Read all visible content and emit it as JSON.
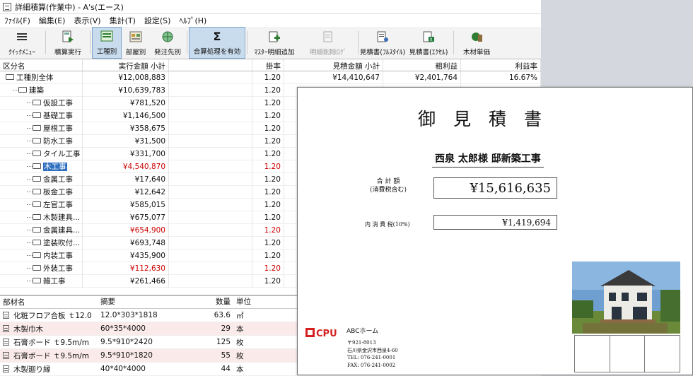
{
  "window": {
    "title": "詳細積算(作業中) - A's(エース)"
  },
  "menu": [
    "ﾌｧｲﾙ(F)",
    "編集(E)",
    "表示(V)",
    "集計(T)",
    "設定(S)",
    "ﾍﾙﾌﾟ(H)"
  ],
  "toolbar": {
    "quickmenu": "ｸｲｯｸﾒﾆｭｰ",
    "estimate_run": "積算実行",
    "by_trade": "工種別",
    "by_room": "部屋別",
    "by_order": "発注先別",
    "sum_enable": "合算処理を有効",
    "master_add": "ﾏｽﾀｰ明細追加",
    "detail_delete": "明細削除ﾛｸﾞ",
    "quote_fullstyle": "見積書(ﾌﾙｽﾀｲﾙ)",
    "quote_excel": "見積書(ｴｸｾﾙ)",
    "wood_price": "木材単価"
  },
  "grid": {
    "headers": {
      "name": "区分名",
      "amount": "実行金額 小計",
      "rate": "掛率",
      "est": "見積金額 小計",
      "profit": "粗利益",
      "pct": "利益率"
    },
    "rows": [
      {
        "name": "工種別全体",
        "amount": "¥12,008,883",
        "rate": "1.20",
        "est": "¥14,410,647",
        "profit": "¥2,401,764",
        "pct": "16.67%",
        "level": 0
      },
      {
        "name": "建築",
        "amount": "¥10,639,783",
        "rate": "1.20",
        "level": 1
      },
      {
        "name": "仮設工事",
        "amount": "¥781,520",
        "rate": "1.20",
        "level": 2
      },
      {
        "name": "基礎工事",
        "amount": "¥1,146,500",
        "rate": "1.20",
        "level": 2
      },
      {
        "name": "屋根工事",
        "amount": "¥358,675",
        "rate": "1.20",
        "level": 2
      },
      {
        "name": "防水工事",
        "amount": "¥31,500",
        "rate": "1.20",
        "level": 2
      },
      {
        "name": "タイル工事",
        "amount": "¥331,700",
        "rate": "1.20",
        "level": 2
      },
      {
        "name": "木工事",
        "amount": "¥4,540,870",
        "rate": "1.20",
        "level": 2,
        "red": true,
        "selected": true
      },
      {
        "name": "金属工事",
        "amount": "¥17,640",
        "rate": "1.20",
        "level": 2
      },
      {
        "name": "板金工事",
        "amount": "¥12,642",
        "rate": "1.20",
        "level": 2
      },
      {
        "name": "左官工事",
        "amount": "¥585,015",
        "rate": "1.20",
        "level": 2
      },
      {
        "name": "木製建具...",
        "amount": "¥675,077",
        "rate": "1.20",
        "level": 2
      },
      {
        "name": "金属建具...",
        "amount": "¥654,900",
        "rate": "1.20",
        "level": 2,
        "red": true
      },
      {
        "name": "塗装吹付...",
        "amount": "¥693,748",
        "rate": "1.20",
        "level": 2
      },
      {
        "name": "内装工事",
        "amount": "¥435,900",
        "rate": "1.20",
        "level": 2
      },
      {
        "name": "外装工事",
        "amount": "¥112,630",
        "rate": "1.20",
        "level": 2,
        "red": true
      },
      {
        "name": "雑工事",
        "amount": "¥261,466",
        "rate": "1.20",
        "level": 2
      }
    ]
  },
  "parts": {
    "headers": {
      "name": "部材名",
      "spec": "摘要",
      "qty": "数量",
      "unit": "単位"
    },
    "rows": [
      {
        "name": "化粧フロア合板 ｔ12.0",
        "spec": "12.0*303*1818",
        "qty": "63.6",
        "unit": "㎡",
        "pink": false
      },
      {
        "name": "木製巾木",
        "spec": "60*35*4000",
        "qty": "29",
        "unit": "本",
        "pink": true
      },
      {
        "name": "石膏ボード ｔ9.5m/m",
        "spec": "9.5*910*2420",
        "qty": "125",
        "unit": "枚",
        "pink": false
      },
      {
        "name": "石膏ボード ｔ9.5m/m",
        "spec": "9.5*910*1820",
        "qty": "55",
        "unit": "枚",
        "pink": true
      },
      {
        "name": "木製廻り縁",
        "spec": "40*40*4000",
        "qty": "44",
        "unit": "本",
        "pink": false
      }
    ]
  },
  "sheet": {
    "title": "御見積書",
    "client": "西泉 太郎様 邸新築工事",
    "total_label_1": "合 計 額",
    "total_label_2": "(消費税含む)",
    "total_value": "¥15,616,635",
    "tax_label": "内 消 費 税(10%)",
    "tax_value": "¥1,419,694",
    "logo": "CPU",
    "company": "ABCホーム",
    "address": [
      "〒921-8013",
      "石川県金沢市西泉4-60",
      "TEL: 076-241-0001",
      "FAX: 076-241-0002"
    ]
  },
  "colors": {
    "red": "#cc0000",
    "selection": "#2e6fc0",
    "toolbar_active": "#c9dcee"
  }
}
